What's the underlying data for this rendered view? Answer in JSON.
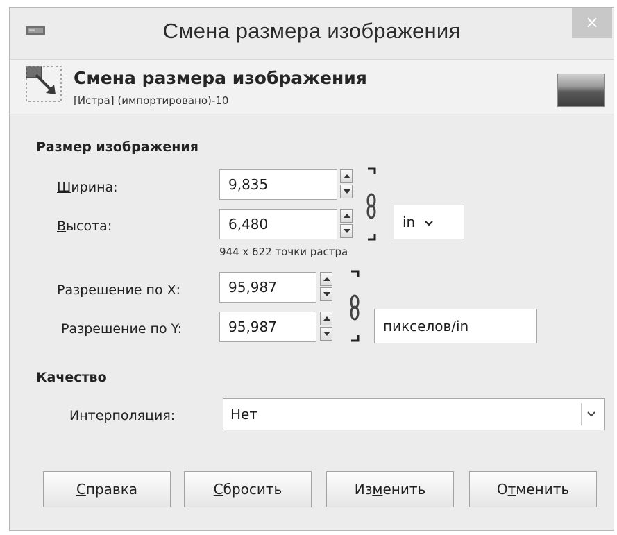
{
  "window": {
    "title": "Смена размера изображения",
    "close_symbol": "×"
  },
  "header": {
    "title": "Смена размера изображения",
    "subtitle": "[Истра] (импортировано)-10",
    "icon": "scale-image-icon",
    "thumbnail": "image-thumbnail"
  },
  "size_section": {
    "title": "Размер изображения",
    "width": {
      "label_accel": "Ш",
      "label_rest": "ирина:",
      "value": "9,835"
    },
    "height": {
      "label_accel": "В",
      "label_rest": "ысота:",
      "value": "6,480"
    },
    "unit": "in",
    "pixel_info": "944 x 622 точки растра",
    "res_x": {
      "label": "Разрешение по X:",
      "value": "95,987"
    },
    "res_y": {
      "label": "Разрешение по Y:",
      "value": "95,987"
    },
    "res_unit": "пикселов/in"
  },
  "quality_section": {
    "title": "Качество",
    "interp_pre": "И",
    "interp_accel": "н",
    "interp_rest": "терполяция:",
    "interp_value": "Нет"
  },
  "buttons": {
    "help": {
      "accel": "С",
      "rest": "правка"
    },
    "reset": {
      "accel": "С",
      "rest": "бросить"
    },
    "apply": {
      "pre": "Из",
      "accel": "м",
      "rest": "енить"
    },
    "cancel": {
      "pre": "О",
      "accel": "т",
      "rest": "менить"
    }
  },
  "colors": {
    "window_bg": "#ececec",
    "header_bg": "#f2f2f2",
    "close_bg": "#c8c8c8"
  }
}
